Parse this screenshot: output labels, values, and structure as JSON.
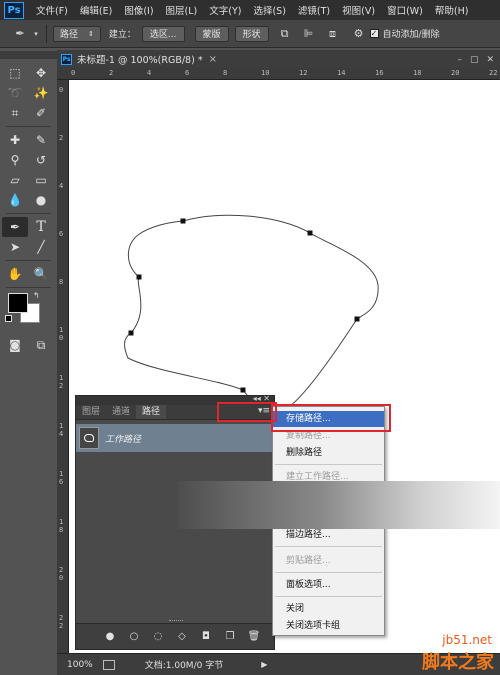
{
  "app": {
    "logo": "Ps",
    "menu": [
      "文件(F)",
      "编辑(E)",
      "图像(I)",
      "图层(L)",
      "文字(Y)",
      "选择(S)",
      "滤镜(T)",
      "视图(V)",
      "窗口(W)",
      "帮助(H)"
    ]
  },
  "options_bar": {
    "tool_icon": "pen-icon",
    "mode_select": "路径",
    "build_label": "建立：",
    "selection_button": "选区...",
    "mask_button": "蒙版",
    "shape_button": "形状",
    "auto_add_delete_label": "自动添加/删除",
    "auto_add_delete_checked": true
  },
  "document": {
    "tab_title": "未标题-1 @ 100%(RGB/8) *",
    "close_glyph": "×"
  },
  "ruler": {
    "top_marks": [
      "0",
      "2",
      "4",
      "6",
      "8",
      "1\n0",
      "1\n2",
      "1\n4",
      "1\n6",
      "1\n8",
      "2\n0",
      "2\n2"
    ],
    "left_marks": [
      "0",
      "2",
      "4",
      "6",
      "8",
      "1\n0",
      "1\n2",
      "1\n4",
      "1\n6",
      "1\n8",
      "2\n0",
      "2\n2"
    ]
  },
  "status": {
    "zoom": "100%",
    "doc_info": "文档:1.00M/0 字节"
  },
  "paths_panel": {
    "tabs": [
      "图层",
      "通道",
      "路径"
    ],
    "active_tab": "路径",
    "path_item": "工作路径"
  },
  "context_menu": {
    "items": [
      {
        "label": "存储路径...",
        "state": "highlight"
      },
      {
        "label": "复制路径...",
        "state": "disabled"
      },
      {
        "label": "删除路径",
        "state": "normal"
      },
      {
        "label": "建立工作路径...",
        "state": "disabled"
      },
      {
        "label": "描边路径...",
        "state": "normal"
      },
      {
        "label": "剪贴路径...",
        "state": "disabled"
      },
      {
        "label": "面板选项...",
        "state": "normal"
      },
      {
        "label": "关闭",
        "state": "normal"
      },
      {
        "label": "关闭选项卡组",
        "state": "normal"
      }
    ]
  },
  "colors": {
    "highlight": "#3c6fc4",
    "annotation_red": "#e0262c",
    "panel_row": "#6f8090"
  },
  "watermark": {
    "url": "jb51.net",
    "text": "脚本之家"
  }
}
